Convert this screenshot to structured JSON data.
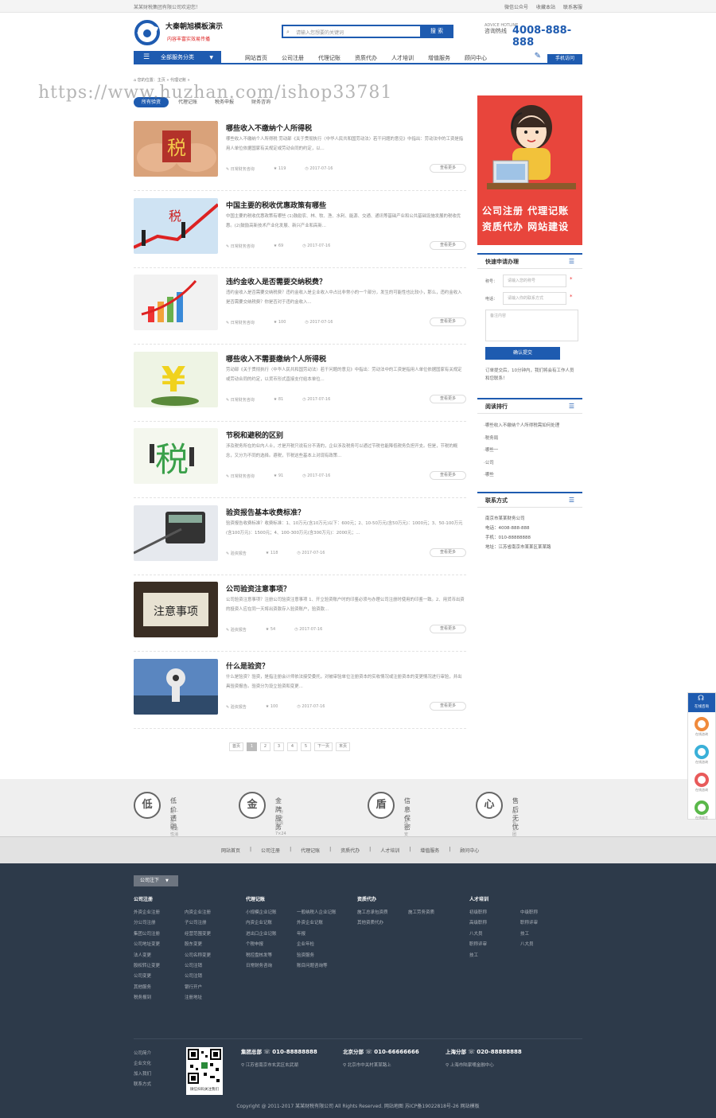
{
  "topbar": {
    "welcome": "某某财税集团有限公司欢迎您！",
    "links": [
      "微信公众号",
      "收藏本站",
      "联系客服"
    ]
  },
  "header": {
    "site_name": "大秦朝旭模板演示",
    "slogan": "内容丰富实效易传播",
    "search_placeholder": "请输入您想要的关键词",
    "search_button": "搜 索",
    "hotline_label_en": "ADVICE HOTLINE",
    "hotline_label": "咨询热线",
    "hotline_number": "4008-888-888"
  },
  "nav": {
    "category_button": "全部服务分类",
    "items": [
      "网站首页",
      "公司注册",
      "代理记账",
      "资质代办",
      "人才培训",
      "增值服务",
      "顾问中心"
    ],
    "mobile": "手机访问"
  },
  "breadcrumb": "您的位置：主页 » 代理记账 »",
  "watermark": "https://www.huzhan.com/ishop33781",
  "tabs": [
    "所有验资",
    "代理记账",
    "税务申报",
    "财务咨询"
  ],
  "articles": [
    {
      "title": "哪些收入不缴纳个人所得税",
      "desc": "哪些收入不缴纳个人所得税 劳动部《关于贯彻执行〈中华人民共和国劳动法〉若干问题的意见》中指出：劳动法中的工资是指用人单位依据国家有关规定或劳动合同的约定，以...",
      "category": "日常财务咨询",
      "views": "119",
      "date": "2017-07-16",
      "more": "查看更多"
    },
    {
      "title": "中国主要的税收优惠政策有哪些",
      "desc": "中国主要的税收优惠政策有哪些 (1)鼓励农、林、牧、渔、水利、能源、交通、通讯等基础产业和公共基础设施发展的税收优惠。(2)鼓励高新技术产业化发展、新兴产业和高新...",
      "category": "日常财务咨询",
      "views": "69",
      "date": "2017-07-16",
      "more": "查看更多"
    },
    {
      "title": "违约金收入是否需要交纳税费？",
      "desc": "违约金收入是否需要交纳税费？违约金收入是企业收入中占比非常小的一个部分，发生的可能性也比较小，那么，违约金收入是否需要交纳税费？你是否对于违约金收入...",
      "category": "日常财务咨询",
      "views": "100",
      "date": "2017-07-16",
      "more": "查看更多"
    },
    {
      "title": "哪些收入不需要缴纳个人所得税",
      "desc": "劳动部《关于贯彻执行〈中华人民共和国劳动法〉若干问题的意见》中指出：劳动法中的工资是指用人单位依据国家有关规定或劳动合同的约定，以货币形式直接支付给本单位...",
      "category": "日常财务咨询",
      "views": "81",
      "date": "2017-07-16",
      "more": "查看更多"
    },
    {
      "title": "节税和避税的区别",
      "desc": "涉及税务所在的业内人士，才是开税只说有分不清的，企业涉及税务可以通过节税也能降低税务负担开支。但是，节税的概念，又分为不同的选择。避税，节税这些基本上对现有政策...",
      "category": "日常财务咨询",
      "views": "91",
      "date": "2017-07-16",
      "more": "查看更多"
    },
    {
      "title": "验资报告基本收费标准？",
      "desc": "验资报告收费标准？收费标准：1、10万元(含10万元)以下：600元；2、10-50万元(含50万元)：1000元；3、50-100万元(含100万元)：1500元；4、100-300万元(含300万元)：2000元；...",
      "category": "验资报告",
      "views": "118",
      "date": "2017-07-16",
      "more": "查看更多"
    },
    {
      "title": "公司验资注意事项？",
      "desc": "公司验资注意事项？注册公司验资注意事项 1、开立验资账户时的印鉴必须与办理公司注册时使用的印鉴一致。2、用货币出资的投资人应在同一天将出资款存入验资账户，验资款...",
      "category": "验资报告",
      "views": "54",
      "date": "2017-07-16",
      "more": "查看更多"
    },
    {
      "title": "什么是验资？",
      "desc": "什么是验资？验资，是指注册会计师依法接受委托，对被审验单位注册资本的实收情况或注册资本的变更情况进行审验，并出具验资报告。验资分为设立验资和变更...",
      "category": "验资报告",
      "views": "100",
      "date": "2017-07-16",
      "more": "查看更多"
    }
  ],
  "pagination": [
    "首页",
    "1",
    "2",
    "3",
    "4",
    "5",
    "下一页",
    "末页"
  ],
  "pagination_current": "1",
  "sidebar": {
    "banner_line1": "公司注册 代理记账",
    "banner_line2": "资质代办 网站建设",
    "quick_title": "快速申请办理",
    "name_label": "称号：",
    "name_placeholder": "请输入您的称号",
    "phone_label": "电话：",
    "phone_placeholder": "请输入你的联系方式",
    "note_placeholder": "备注内容",
    "submit": "确认提交",
    "tip": "订单提交后，10分钟内，我们将会有工作人员和您联系！",
    "rank_title": "阅读排行",
    "rank_items": [
      "·哪些收入不缴纳个人所得税需如何处理",
      "·税务局",
      "·哪些一",
      "·公司",
      "·哪些"
    ],
    "contact_title": "联系方式",
    "contact_lines": [
      "南京市某某财务公司",
      "电话：4008-888-888",
      "手机：010-88888888",
      "地址：江苏省南京市某某区某某路"
    ]
  },
  "features": [
    {
      "icon": "低",
      "title": "低价透明",
      "desc": "统一报价，无隐性消费"
    },
    {
      "icon": "金",
      "title": "金牌服务",
      "desc": "一对一专属顾问7×24小时金牌服务"
    },
    {
      "icon": "盾",
      "title": "信息保密",
      "desc": "个人信息安全有保障"
    },
    {
      "icon": "心",
      "title": "售后无忧",
      "desc": "配合专业团队全程提供售后服务"
    }
  ],
  "footer_nav": [
    "网站首页",
    "公司注册",
    "代理记账",
    "资质代办",
    "人才培训",
    "增值服务",
    "顾问中心"
  ],
  "footer": {
    "button": "公司注下",
    "columns": [
      {
        "title": "公司注册",
        "links": [
          "外资企业注册",
          "内资企业注册",
          "分公司注册",
          "子公司注册",
          "集团公司注册",
          "经营范围变更",
          "公司地址变更",
          "股东变更",
          "法人变更",
          "公司名称变更",
          "股权转让变更",
          "公司注销",
          "公司变更",
          "公司注销",
          "其他服务",
          "银行开户",
          "税务报到",
          "注册地址"
        ]
      },
      {
        "title": "代理记账",
        "links": [
          "小规模企业记账",
          "一般纳税人企业记账",
          "内资企业记账",
          "外资企业记账",
          "进出口企业记账",
          "年报",
          "个税申报",
          "企业年检",
          "税控盘核发等",
          "验资服务",
          "日常财务咨询",
          "账目问题咨询等"
        ]
      },
      {
        "title": "资质代办",
        "links": [
          "施工总承包资质",
          "施工劳务资质",
          "其他资质代办"
        ]
      },
      {
        "title": "人才培训",
        "links": [
          "初级职称",
          "中级职称",
          "高级职称",
          "职称评审",
          "八大员",
          "技工",
          "职称评审",
          "八大员",
          "技工"
        ]
      }
    ],
    "company_links": [
      "公司简介",
      "企业文化",
      "加入我们",
      "联系方式"
    ],
    "qr_caption": "微信扫码关注我们",
    "offices": [
      {
        "name": "集团总部",
        "phone": "010-88888888",
        "address": "江苏省南京市玄武区玄武湖"
      },
      {
        "name": "北京分部",
        "phone": "010-66666666",
        "address": "北京市中关村某某路上"
      },
      {
        "name": "上海分部",
        "phone": "020-88888888",
        "address": "上海市陆家嘴金融中心"
      }
    ],
    "copyright": "Copyright @ 2011-2017 某某财税有限公司 All Rights Reserved.  网站地图  苏ICP备19022818号-26  网站模板"
  },
  "float_widget": {
    "head": "在线咨询",
    "items": [
      "在线咨询",
      "在线咨询",
      "在线咨询",
      "在线留言"
    ]
  },
  "colors": {
    "brand_blue": "#1e5bb0",
    "banner_red": "#e8453c",
    "footer_dark": "#2d3a4a"
  }
}
